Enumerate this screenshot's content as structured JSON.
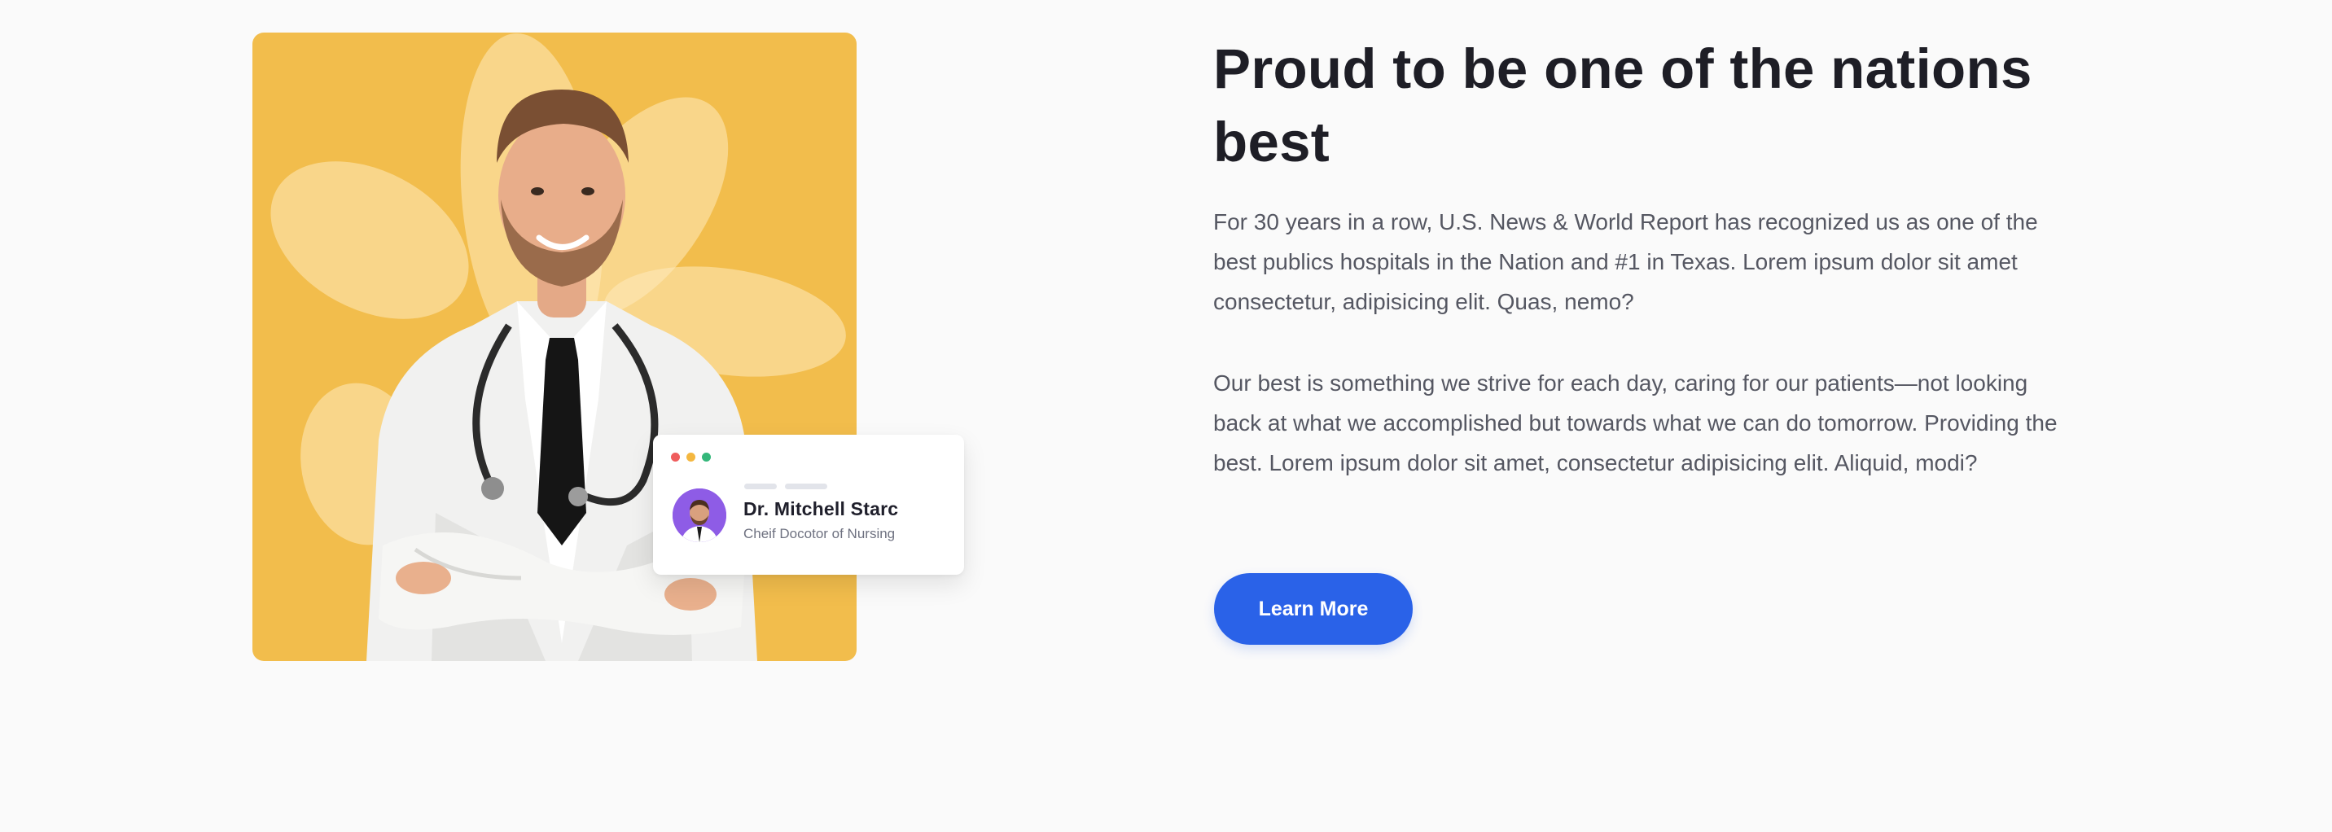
{
  "hero": {
    "title": "Proud to be one of the nations best",
    "paragraph_1": "For 30 years in a row, U.S. News & World Report has recognized us as one of the best publics hospitals in the Nation and #1 in Texas. Lorem ipsum dolor sit amet consectetur, adipisicing elit. Quas, nemo?",
    "paragraph_2": "Our best is something we strive for each day, caring for our patients—not looking back at what we accomplished but towards what we can do tomorrow. Providing the best. Lorem ipsum dolor sit amet, consectetur adipisicing elit. Aliquid, modi?",
    "cta_label": "Learn More"
  },
  "profile_card": {
    "name": "Dr. Mitchell Starc",
    "role": "Cheif Docotor of Nursing"
  },
  "icons": {
    "window_dots": [
      "red-dot",
      "yellow-dot",
      "green-dot"
    ],
    "avatar": "doctor-avatar-icon"
  },
  "colors": {
    "image_background": "#f2bd4c",
    "button": "#2a62e8",
    "avatar_background": "#8e5ce6",
    "dot_red": "#ef5d5d",
    "dot_yellow": "#f4b740",
    "dot_green": "#34b77a"
  }
}
